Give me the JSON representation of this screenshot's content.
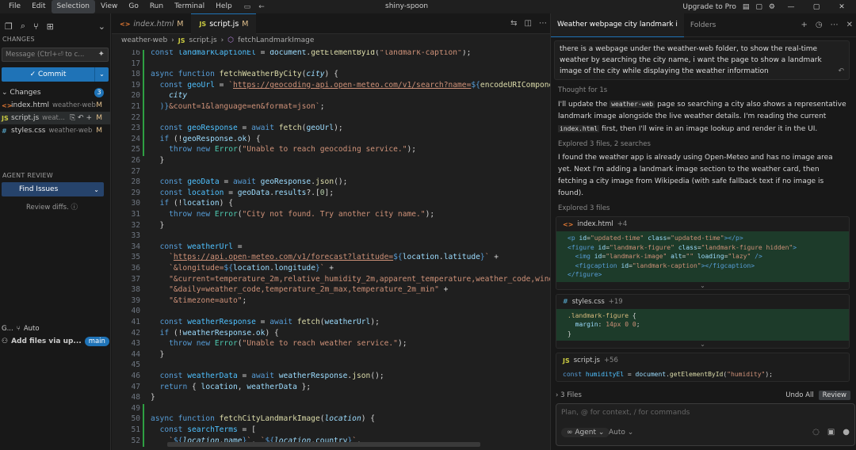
{
  "titlebar": {
    "menu": [
      "File",
      "Edit",
      "Selection",
      "View",
      "Go",
      "Run",
      "Terminal",
      "Help"
    ],
    "active_menu": "Selection",
    "window_title": "shiny-spoon",
    "upgrade": "Upgrade to Pro"
  },
  "sidebar": {
    "changes_title": "CHANGES",
    "message_placeholder": "Message (Ctrl+⏎ to c...",
    "commit_label": "Commit",
    "changes_label": "Changes",
    "changes_count": "3",
    "files": [
      {
        "icon": "<>",
        "name": "index.html",
        "dir": "weather-web",
        "status": "M"
      },
      {
        "icon": "JS",
        "name": "script.js",
        "dir": "weat...",
        "status": "M"
      },
      {
        "icon": "#",
        "name": "styles.css",
        "dir": "weather-web",
        "status": "M"
      }
    ],
    "agent_review_title": "AGENT REVIEW",
    "find_issues_label": "Find Issues",
    "review_diffs": "Review diffs.",
    "g_label": "G...",
    "auto_label": "Auto",
    "add_files": "Add files via up...",
    "branch": "main"
  },
  "editor": {
    "tabs": [
      {
        "icon": "<>",
        "name": "index.html",
        "status": "M"
      },
      {
        "icon": "JS",
        "name": "script.js",
        "status": "M"
      }
    ],
    "breadcrumbs": [
      "weather-web",
      "script.js",
      "fetchLandmarkImage"
    ],
    "line_numbers": [
      "16",
      "17",
      "18",
      "19",
      "20",
      "21",
      "22",
      "23",
      "24",
      "25",
      "26",
      "27",
      "28",
      "29",
      "30",
      "31",
      "32",
      "33",
      "34",
      "35",
      "36",
      "37",
      "38",
      "39",
      "40",
      "41",
      "42",
      "43",
      "44",
      "45",
      "46",
      "47",
      "48",
      "49",
      "50",
      "51",
      "52"
    ]
  },
  "panel": {
    "tabs": [
      "Weather webpage city landmark i",
      "Folders"
    ],
    "user_message": "there is a webpage under the weather-web folder, to show the real-time weather by searching the city name, i want the page to show a landmark image of the city while displaying the weather information",
    "thought": "Thought for 1s",
    "para1_a": "I'll update the",
    "para1_code1": "weather-web",
    "para1_b": "page so searching a city also shows a representative landmark image alongside the live weather details. I'm reading the current",
    "para1_code2": "index.html",
    "para1_c": "first, then I'll wire in an image lookup and render it in the UI.",
    "explored1": "Explored 3 files, 2 searches",
    "para2": "I found the weather app is already using Open-Meteo and has no image area yet. Next I'm adding a landmark image section to the weather card, then fetching a city image from Wikipedia (with safe fallback text if no image is found).",
    "explored2": "Explored 3 files",
    "cards": [
      {
        "icon": "<>",
        "name": "index.html",
        "delta": "+4"
      },
      {
        "icon": "#",
        "name": "styles.css",
        "delta": "+19"
      },
      {
        "icon": "JS",
        "name": "script.js",
        "delta": "+56"
      }
    ],
    "files_count": "3 Files",
    "undo_all": "Undo All",
    "review": "Review",
    "input_placeholder": "Plan, @ for context, / for commands",
    "agent": "Agent",
    "auto": "Auto"
  }
}
